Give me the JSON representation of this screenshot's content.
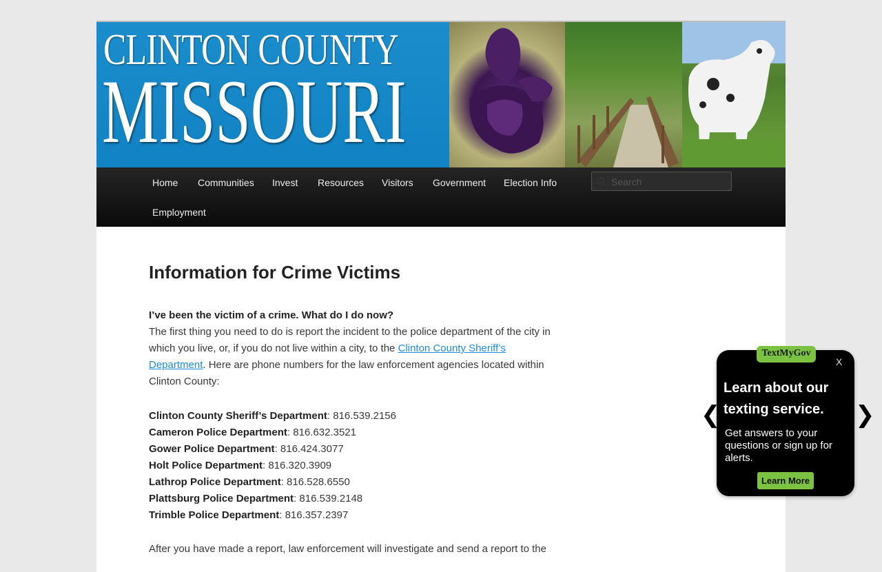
{
  "banner": {
    "line1": "CLINTON COUNTY",
    "line2": "MISSOURI"
  },
  "nav": {
    "items": [
      "Home",
      "Communities",
      "Invest",
      "Resources",
      "Visitors",
      "Government",
      "Election Info",
      "Employment"
    ],
    "search_placeholder": "Search"
  },
  "article": {
    "title": "Information for Crime Victims",
    "question": "I’ve been the victim of a crime. What do I do now?",
    "intro_before_link": "The first thing you need to do is report the incident to the police department of the city in which you live, or, if you do not live within a city, to the ",
    "intro_link": "Clinton County Sheriff’s Department",
    "intro_after_link": ". Here are phone numbers for the law enforcement agencies located within Clinton County:",
    "agencies": [
      {
        "name": "Clinton County Sheriff’s Department",
        "phone": ": 816.539.2156"
      },
      {
        "name": "Cameron Police Department",
        "phone": ": 816.632.3521"
      },
      {
        "name": "Gower Police Department",
        "phone": ": 816.424.3077"
      },
      {
        "name": "Holt Police Department",
        "phone": ": 816.320.3909"
      },
      {
        "name": "Lathrop Police Department",
        "phone": ": 816.528.6550"
      },
      {
        "name": "Plattsburg Police Department",
        "phone": ": 816.539.2148"
      },
      {
        "name": "Trimble Police Department",
        "phone": ": 816.357.2397"
      }
    ],
    "after_report": "After you have made a report, law enforcement will investigate and send a report to the"
  },
  "popup": {
    "brand": "TextMyGov",
    "close": "X",
    "headline": "Learn about our texting service.",
    "body": "Get answers to your questions or sign up for alerts.",
    "button": "Learn More",
    "prev_arrow": "❮",
    "next_arrow": "❯"
  },
  "colors": {
    "banner_blue": "#1183c4",
    "nav_bg": "#0a0a0a",
    "link": "#1b8be0",
    "popup_accent": "#7cc242"
  }
}
